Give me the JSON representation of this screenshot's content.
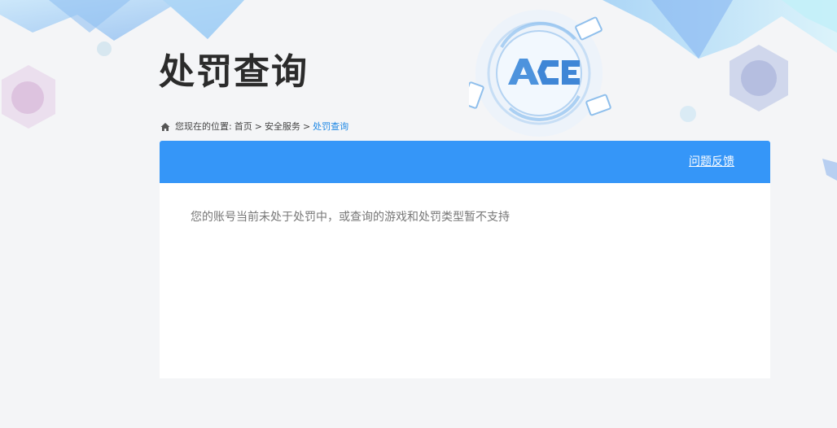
{
  "page": {
    "title": "处罚查询"
  },
  "breadcrumb": {
    "prefix": "您现在的位置:",
    "items": [
      "首页",
      "安全服务"
    ],
    "separator": ">",
    "current": "处罚查询"
  },
  "panel": {
    "feedback_label": "问题反馈",
    "message": "您的账号当前未处于处罚中，或查询的游戏和处罚类型暂不支持"
  },
  "colors": {
    "header_blue": "#3596f8",
    "breadcrumb_current": "#1e88e5",
    "title": "#2b2b2b",
    "background": "#f4f5f7"
  }
}
